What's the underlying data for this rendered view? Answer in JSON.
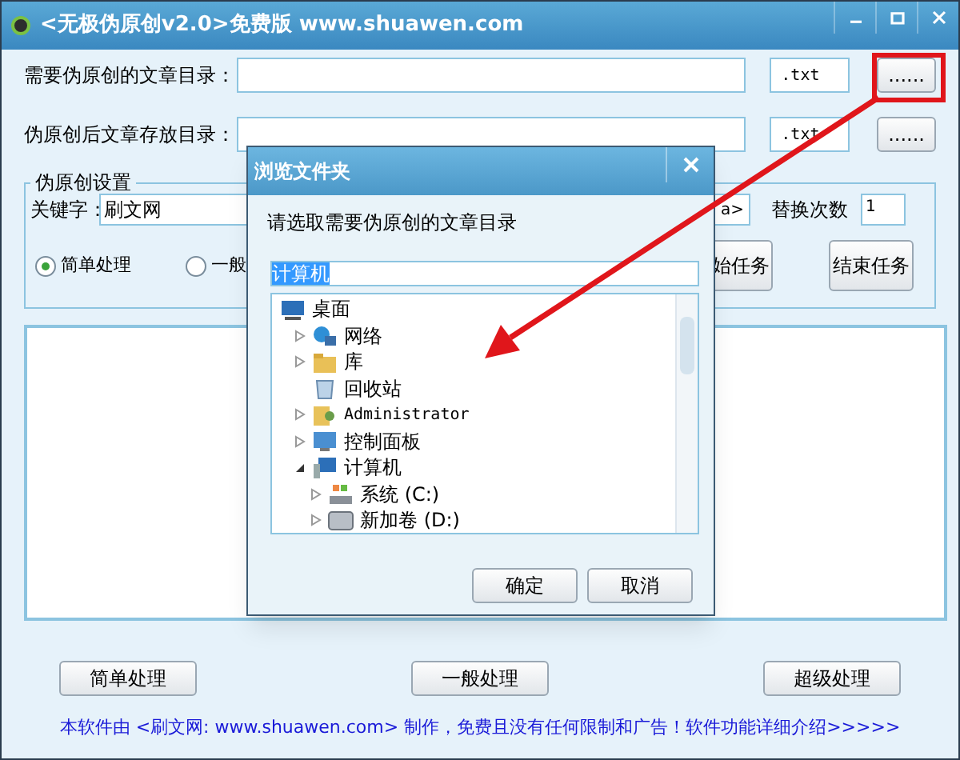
{
  "window": {
    "title": "<无极伪原创v2.0>免费版 www.shuawen.com"
  },
  "paths": [
    {
      "label": "需要伪原创的文章目录：",
      "extension": ".txt",
      "button": "......"
    },
    {
      "label": "伪原创后文章存放目录：",
      "extension": ".txt",
      "button": "......"
    }
  ],
  "settings": {
    "title": "伪原创设置",
    "keyword_label": "关键字：",
    "keyword": "刷文网",
    "link_field": "a>",
    "count_label": "替换次数",
    "count": "1",
    "modes": [
      {
        "label": "简单处理",
        "selected": true
      },
      {
        "label": "一般",
        "selected": false
      }
    ],
    "buttons": [
      "始任务",
      "结束任务"
    ]
  },
  "bottom_buttons": [
    "简单处理",
    "一般处理",
    "超级处理"
  ],
  "footer": "本软件由 <刷文网: www.shuawen.com> 制作，免费且没有任何限制和广告！软件功能详细介绍>>>>>",
  "dialog": {
    "title": "浏览文件夹",
    "prompt": "请选取需要伪原创的文章目录",
    "path": "计算机",
    "path_selected": true,
    "tree": [
      {
        "label": "桌面",
        "kind": "desktop",
        "children": [
          {
            "label": "网络",
            "kind": "network",
            "expanded": false
          },
          {
            "label": "库",
            "kind": "library",
            "expanded": false
          },
          {
            "label": "回收站",
            "kind": "recycle"
          },
          {
            "label": "Administrator",
            "kind": "user",
            "expanded": false
          },
          {
            "label": "控制面板",
            "kind": "control-panel",
            "expanded": false
          },
          {
            "label": "计算机",
            "kind": "computer",
            "expanded": true,
            "children": [
              {
                "label": "系统 (C:)",
                "kind": "system-drive",
                "expanded": false
              },
              {
                "label": "新加卷 (D:)",
                "kind": "drive",
                "expanded": false
              }
            ]
          }
        ]
      }
    ],
    "buttons": [
      "确定",
      "取消"
    ]
  }
}
